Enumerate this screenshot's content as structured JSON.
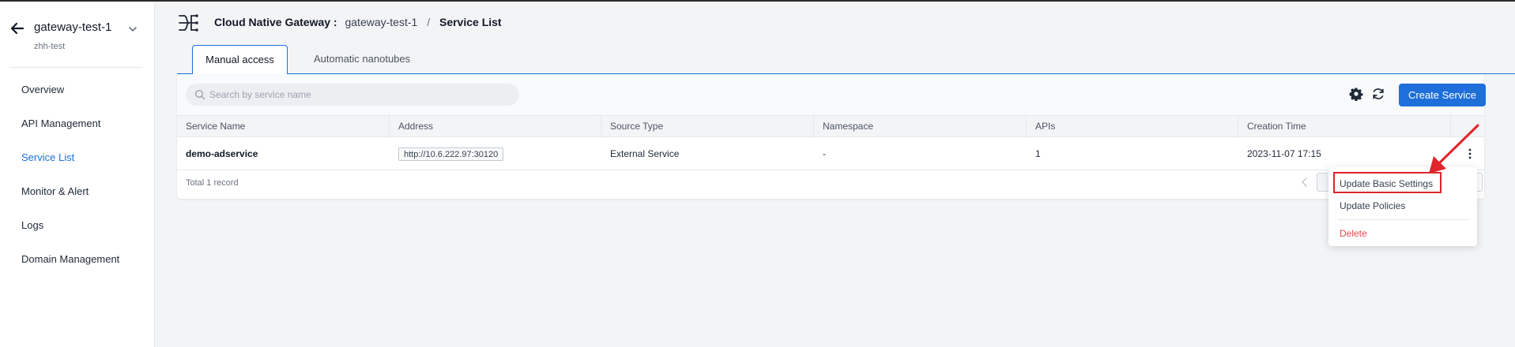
{
  "sidebar": {
    "gateway_name": "gateway-test-1",
    "workspace": "zhh-test",
    "items": [
      {
        "label": "Overview",
        "active": false
      },
      {
        "label": "API Management",
        "active": false
      },
      {
        "label": "Service List",
        "active": true
      },
      {
        "label": "Monitor & Alert",
        "active": false
      },
      {
        "label": "Logs",
        "active": false
      },
      {
        "label": "Domain Management",
        "active": false
      }
    ]
  },
  "header": {
    "root": "Cloud Native Gateway :",
    "gateway": "gateway-test-1",
    "separator": "/",
    "current": "Service List"
  },
  "tabs": [
    {
      "label": "Manual access",
      "active": true
    },
    {
      "label": "Automatic nanotubes",
      "active": false
    }
  ],
  "toolbar": {
    "search_placeholder": "Search by service name",
    "create_label": "Create Service"
  },
  "table": {
    "columns": [
      "Service Name",
      "Address",
      "Source Type",
      "Namespace",
      "APIs",
      "Creation Time"
    ],
    "rows": [
      {
        "name": "demo-adservice",
        "address": "http://10.6.222.97:30120",
        "source_type": "External Service",
        "namespace": "-",
        "apis": "1",
        "created": "2023-11-07 17:15"
      }
    ],
    "total": "Total 1 record"
  },
  "menu": {
    "items": [
      "Update Basic Settings",
      "Update Policies"
    ],
    "danger": "Delete"
  },
  "colors": {
    "accent": "#1e6fd9",
    "danger": "#e5484d",
    "annotation": "#e0252b"
  }
}
